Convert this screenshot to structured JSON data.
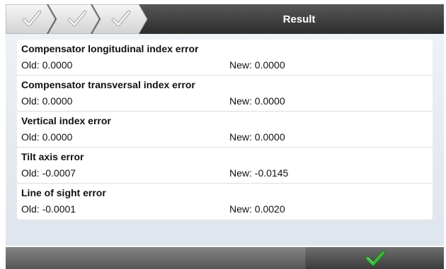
{
  "header": {
    "steps": [
      {
        "icon": "check-icon",
        "state": "done"
      },
      {
        "icon": "check-icon",
        "state": "done"
      },
      {
        "icon": "check-icon",
        "state": "done"
      }
    ],
    "title": "Result"
  },
  "results": [
    {
      "title": "Compensator longitudinal index error",
      "old": "Old: 0.0000",
      "new": "New: 0.0000"
    },
    {
      "title": "Compensator transversal index error",
      "old": "Old: 0.0000",
      "new": "New: 0.0000"
    },
    {
      "title": "Vertical index error",
      "old": "Old: 0.0000",
      "new": "New: 0.0000"
    },
    {
      "title": "Tilt axis error",
      "old": "Old: -0.0007",
      "new": "New: -0.0145"
    },
    {
      "title": "Line of sight error",
      "old": "Old: -0.0001",
      "new": "New: 0.0020"
    }
  ],
  "footer": {
    "confirm_icon": "green-check-icon",
    "colors": {
      "accent_check": "#3cb43c"
    }
  }
}
